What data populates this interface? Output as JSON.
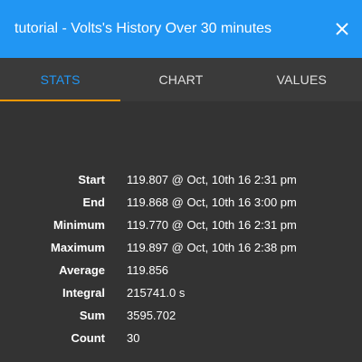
{
  "header": {
    "title": "tutorial - Volts's History Over 30 minutes",
    "close_icon": "close-icon",
    "background": "#2196f3"
  },
  "tabs": [
    {
      "label": "STATS",
      "active": true
    },
    {
      "label": "CHART",
      "active": false
    },
    {
      "label": "VALUES",
      "active": false
    }
  ],
  "accent": "#ff9800",
  "stats": [
    {
      "label": "Start",
      "value": "119.807 @ Oct, 10th 16 2:31 pm"
    },
    {
      "label": "End",
      "value": "119.868 @ Oct, 10th 16 3:00 pm"
    },
    {
      "label": "Minimum",
      "value": "119.770 @ Oct, 10th 16 2:31 pm"
    },
    {
      "label": "Maximum",
      "value": "119.897 @ Oct, 10th 16 2:38 pm"
    },
    {
      "label": "Average",
      "value": "119.856"
    },
    {
      "label": "Integral",
      "value": "215741.0 s"
    },
    {
      "label": "Sum",
      "value": "3595.702"
    },
    {
      "label": "Count",
      "value": "30"
    }
  ]
}
